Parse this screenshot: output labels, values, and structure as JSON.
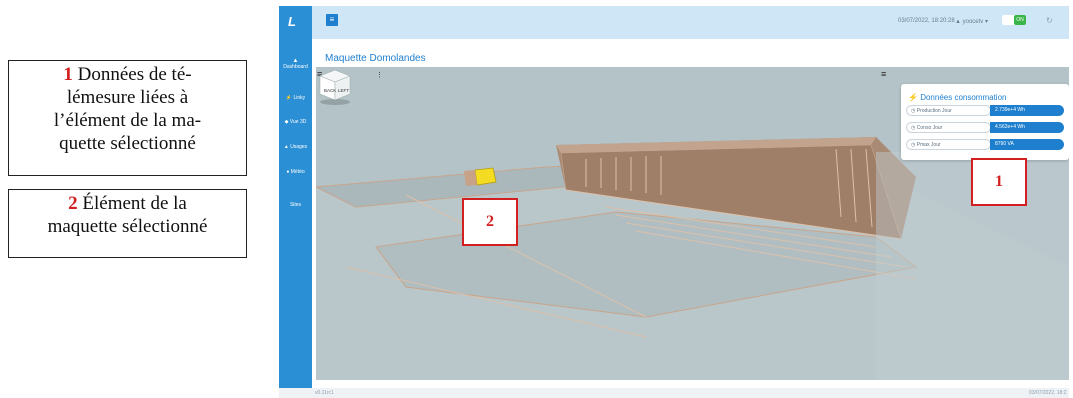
{
  "callouts": [
    {
      "number": "1",
      "line1": "Données de té-",
      "line2": "lémesure liées à",
      "line3": "l’élément de la ma-",
      "line4": "quette sélectionné"
    },
    {
      "number": "2",
      "line1": "Élément de la",
      "line2": "maquette sélectionné"
    }
  ],
  "sidebar": {
    "logo": "L",
    "items": [
      {
        "label": "Dashboard",
        "icon": "chart-icon"
      },
      {
        "label": "Linky",
        "icon": "bolt-icon"
      },
      {
        "label": "Vue 3D",
        "icon": "cube-icon"
      },
      {
        "label": "Usages",
        "icon": "usage-icon"
      },
      {
        "label": "Météo",
        "icon": "drop-icon"
      },
      {
        "label": "Sites",
        "icon": ""
      }
    ]
  },
  "topbar": {
    "datetime": "03/07/2022, 18:20:28",
    "user": "yoocetv",
    "toggle_label": "ON"
  },
  "page": {
    "title": "Maquette Domolandes"
  },
  "panel": {
    "title": "Données consommation",
    "rows": [
      {
        "label": "Production Jour",
        "value": "2.739e+4 Wh"
      },
      {
        "label": "Conso Jour",
        "value": "4.562e+4 Wh"
      },
      {
        "label": "Pmax Jour",
        "value": "8790 VA"
      }
    ]
  },
  "markers": [
    "1",
    "2"
  ],
  "viewcube": {
    "face1": "BACK",
    "face2": "LEFT"
  },
  "statusbar": {
    "left": "v0.11rc1",
    "right": "03/07/2022, 18:2"
  },
  "colors": {
    "accent": "#1f7fcf",
    "sidebar": "#2a8fd4",
    "marker": "#d21f1f",
    "selected_element": "#f3dc22"
  }
}
